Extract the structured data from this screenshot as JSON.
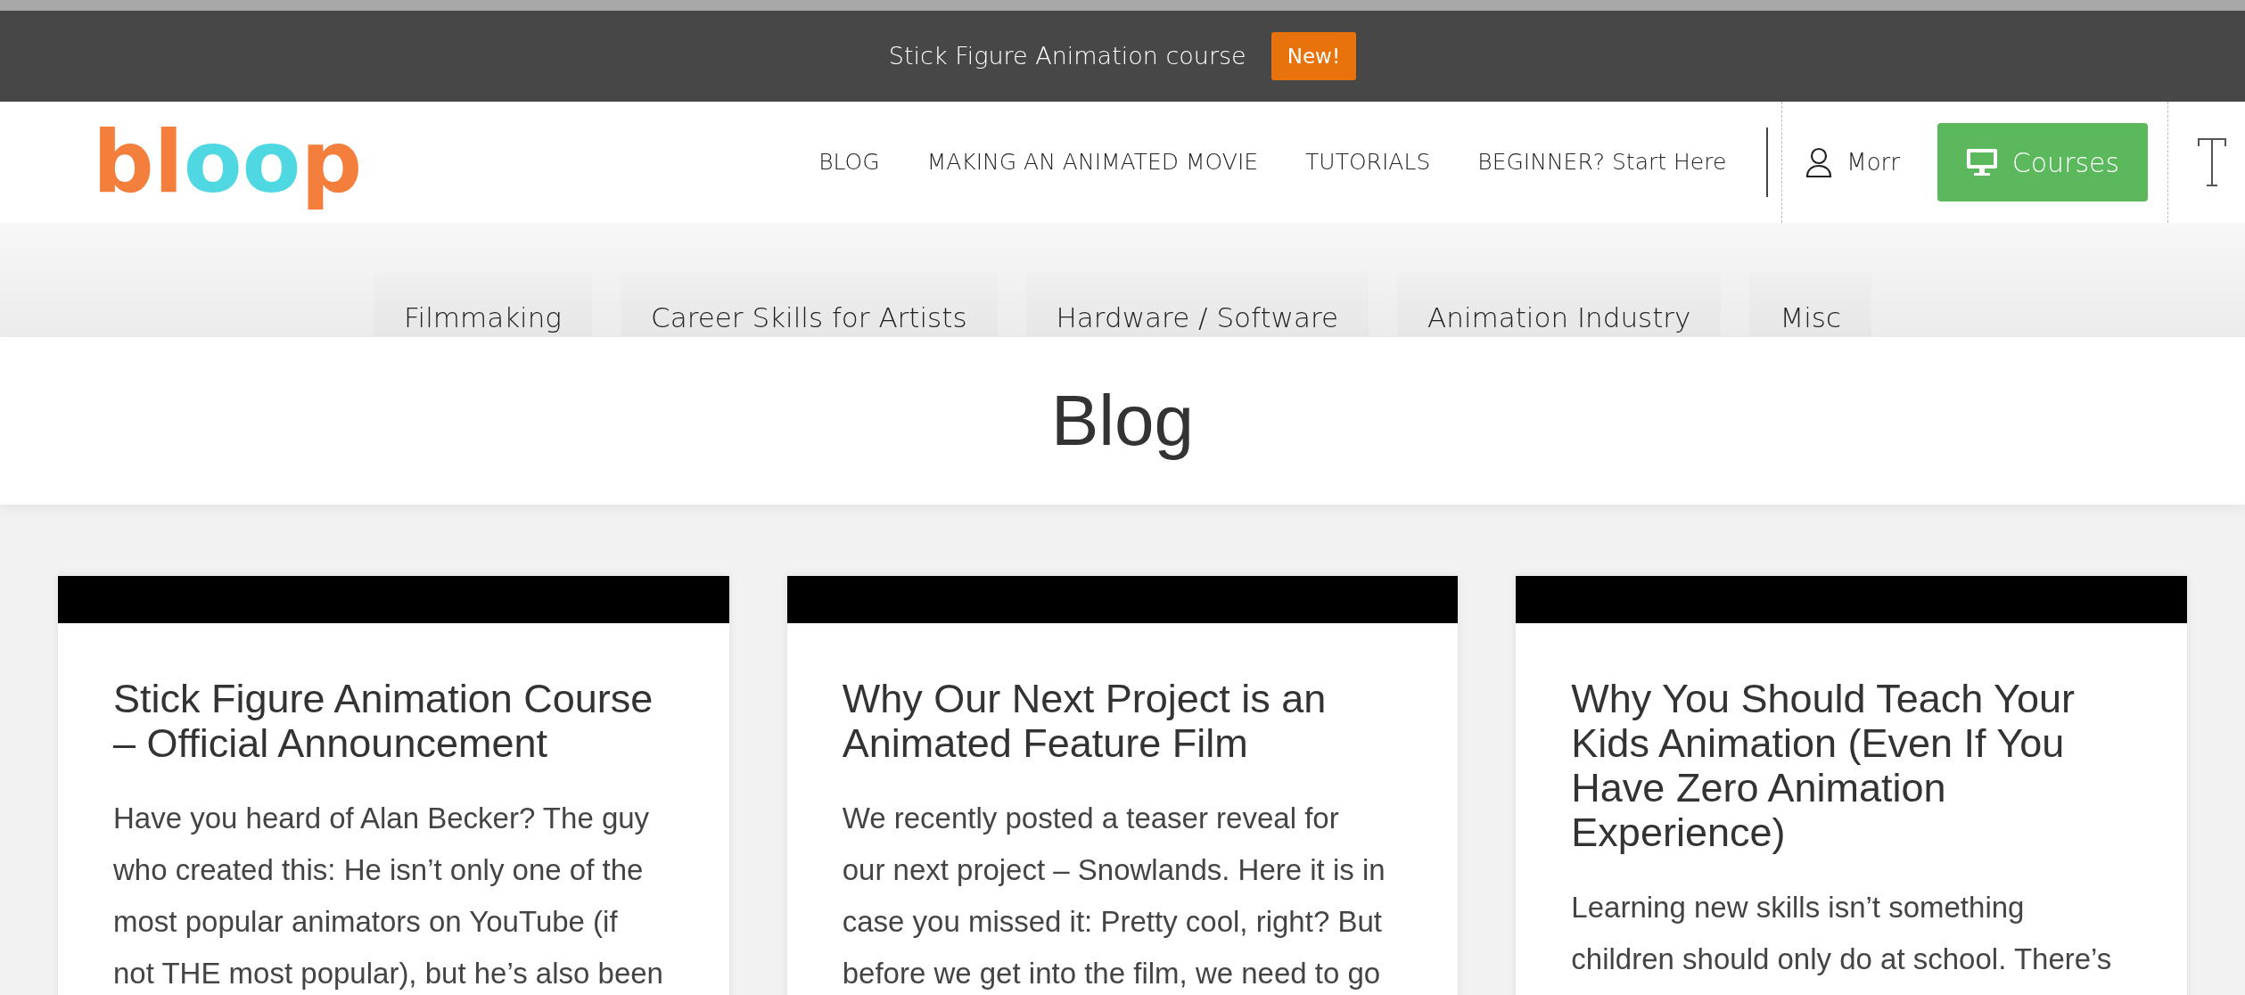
{
  "announcement": {
    "text": "Stick Figure Animation course",
    "badge": "New!"
  },
  "logo": {
    "parts": [
      {
        "text": "bl",
        "color": "#f47f3c"
      },
      {
        "text": "oo",
        "color": "#4fd8e2"
      },
      {
        "text": "p",
        "color": "#f47f3c"
      }
    ]
  },
  "nav": {
    "items": [
      "BLOG",
      "MAKING AN ANIMATED MOVIE",
      "TUTORIALS",
      "BEGINNER? Start Here"
    ],
    "account": "Morr",
    "courses_button": "Courses"
  },
  "categories": [
    "Filmmaking",
    "Career Skills for Artists",
    "Hardware / Software",
    "Animation Industry",
    "Misc"
  ],
  "page_title": "Blog",
  "posts": [
    {
      "title_lines": [
        "Stick Figure Animation Course",
        "– Official Announcement"
      ],
      "excerpt_lines": [
        "Have you heard of Alan Becker? The guy",
        "who created this: He isn’t only one of the",
        "most popular animators on YouTube (if",
        "not THE most popular), but he’s also been"
      ]
    },
    {
      "title_lines": [
        "Why Our Next Project is an",
        "Animated Feature Film"
      ],
      "excerpt_lines": [
        "We recently posted a teaser reveal for",
        "our next project – Snowlands. Here it is in",
        "case you missed it: Pretty cool, right? But",
        "before we get into the film, we need to go"
      ]
    },
    {
      "title_lines": [
        "Why You Should Teach Your",
        "Kids Animation (Even If You",
        "Have Zero Animation",
        "Experience)"
      ],
      "excerpt_lines": [
        "Learning new skills isn’t something",
        "children should only do at school. There’s"
      ]
    }
  ]
}
